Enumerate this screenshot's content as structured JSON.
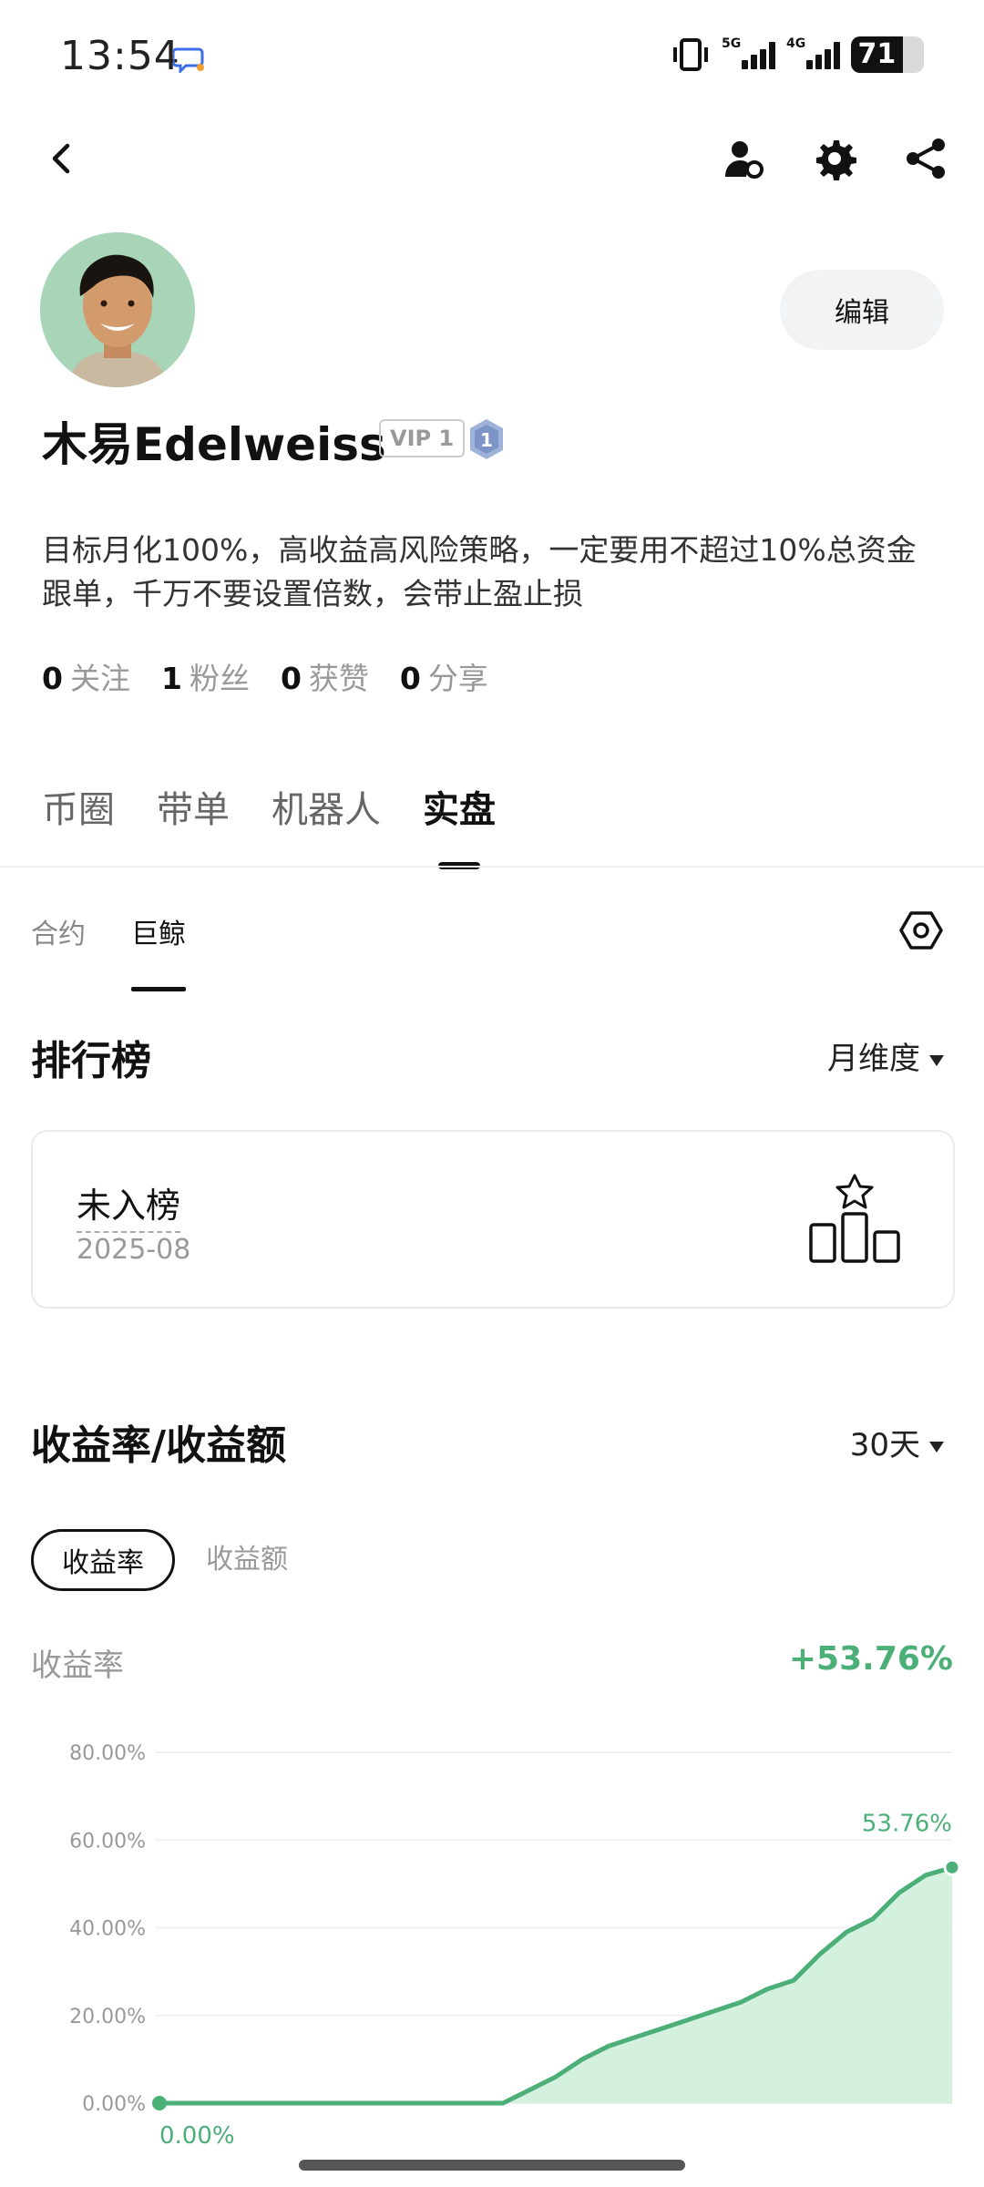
{
  "status_bar": {
    "time": "13:54",
    "net1": "5G",
    "net2": "4G",
    "battery": "71",
    "battery_level": 0.71
  },
  "header": {
    "back_icon": "chevron-left-icon",
    "icons": [
      "user-settings-icon",
      "gear-icon",
      "share-icon"
    ]
  },
  "profile": {
    "name": "木易Edelweiss",
    "vip": "VIP 1",
    "level": "1",
    "edit_label": "编辑",
    "bio": "目标月化100%，高收益高风险策略，一定要用不超过10%总资金跟单，千万不要设置倍数，会带止盈止损",
    "stats": [
      {
        "value": "0",
        "label": "关注"
      },
      {
        "value": "1",
        "label": "粉丝"
      },
      {
        "value": "0",
        "label": "获赞"
      },
      {
        "value": "0",
        "label": "分享"
      }
    ]
  },
  "main_tabs": [
    "币圈",
    "带单",
    "机器人",
    "实盘"
  ],
  "main_tab_active": 3,
  "sub_tabs": [
    "合约",
    "巨鲸"
  ],
  "sub_tab_active": 1,
  "ranking": {
    "title": "排行榜",
    "period": "月维度",
    "status": "未入榜",
    "date": "2025-08"
  },
  "profit": {
    "title": "收益率/收益额",
    "period": "30天",
    "toggle_rate": "收益率",
    "toggle_amount": "收益额",
    "metric_label": "收益率",
    "metric_value": "+53.76%"
  },
  "colors": {
    "accent_green": "#4caf78",
    "area_green": "#cdeedb"
  },
  "chart_data": {
    "type": "area",
    "y_ticks": [
      "80.00%",
      "60.00%",
      "40.00%",
      "20.00%",
      "0.00%"
    ],
    "ylim": [
      0,
      80
    ],
    "x": [
      1,
      2,
      3,
      4,
      5,
      6,
      7,
      8,
      9,
      10,
      11,
      12,
      13,
      14,
      15,
      16,
      17,
      18,
      19,
      20,
      21,
      22,
      23,
      24,
      25,
      26,
      27,
      28,
      29,
      30,
      31
    ],
    "values": [
      0,
      0,
      0,
      0,
      0,
      0,
      0,
      0,
      0,
      0,
      0,
      0,
      0,
      0,
      3,
      6,
      10,
      13,
      15,
      17,
      19,
      21,
      23,
      26,
      28,
      34,
      39,
      42,
      48,
      52,
      53.76
    ],
    "start_label": "0.00%",
    "end_label": "53.76%",
    "grid": true
  }
}
